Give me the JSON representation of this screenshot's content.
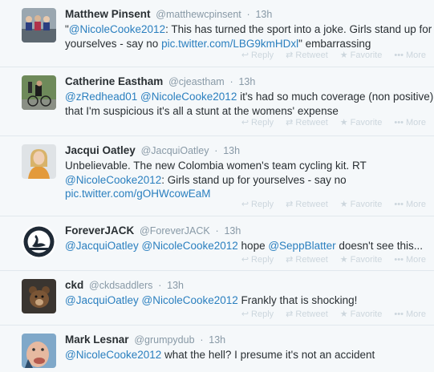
{
  "actions": {
    "reply": "Reply",
    "retweet": "Retweet",
    "favorite": "Favorite",
    "more": "More"
  },
  "tweets": [
    {
      "name": "Matthew Pinsent",
      "handle": "@matthewcpinsent",
      "time": "13h",
      "line1": [
        {
          "t": "\"",
          "c": "txt"
        },
        {
          "t": "@NicoleCooke2012",
          "c": "link"
        },
        {
          "t": ": This has turned the sport into a joke. Girls stand up for",
          "c": "txt"
        }
      ],
      "line2": [
        {
          "t": "yourselves - say no ",
          "c": "txt"
        },
        {
          "t": "pic.twitter.com/LBG9kmHDxl",
          "c": "link"
        },
        {
          "t": "\" embarrassing",
          "c": "txt"
        }
      ],
      "line3": []
    },
    {
      "name": "Catherine Eastham",
      "handle": "@cjeastham",
      "time": "13h",
      "line1": [
        {
          "t": "@zRedhead01",
          "c": "link"
        },
        {
          "t": " ",
          "c": "txt"
        },
        {
          "t": "@NicoleCooke2012",
          "c": "link"
        },
        {
          "t": " it's had so much coverage (non positive)",
          "c": "txt"
        }
      ],
      "line2": [
        {
          "t": "that I'm suspicious it's all a stunt at the womens' expense",
          "c": "txt"
        }
      ],
      "line3": []
    },
    {
      "name": "Jacqui Oatley",
      "handle": "@JacquiOatley",
      "time": "13h",
      "line1": [
        {
          "t": "Unbelievable. The new Colombia women's team cycling kit. RT",
          "c": "txt"
        }
      ],
      "line2": [
        {
          "t": "@NicoleCooke2012",
          "c": "link"
        },
        {
          "t": ": Girls stand up for yourselves - say no",
          "c": "txt"
        }
      ],
      "line3": [
        {
          "t": "pic.twitter.com/gOHWcowEaM",
          "c": "link"
        }
      ]
    },
    {
      "name": "ForeverJACK",
      "handle": "@ForeverJACK",
      "time": "13h",
      "line1": [
        {
          "t": "@JacquiOatley",
          "c": "link"
        },
        {
          "t": " ",
          "c": "txt"
        },
        {
          "t": "@NicoleCooke2012",
          "c": "link"
        },
        {
          "t": " hope ",
          "c": "txt"
        },
        {
          "t": "@SeppBlatter",
          "c": "link"
        },
        {
          "t": " doesn't see this...",
          "c": "txt"
        }
      ],
      "line2": [],
      "line3": []
    },
    {
      "name": "ckd",
      "handle": "@ckdsaddlers",
      "time": "13h",
      "line1": [
        {
          "t": "@JacquiOatley",
          "c": "link"
        },
        {
          "t": " ",
          "c": "txt"
        },
        {
          "t": "@NicoleCooke2012",
          "c": "link"
        },
        {
          "t": " Frankly that is shocking!",
          "c": "txt"
        }
      ],
      "line2": [],
      "line3": []
    },
    {
      "name": "Mark Lesnar",
      "handle": "@grumpydub",
      "time": "13h",
      "line1": [
        {
          "t": "@NicoleCooke2012",
          "c": "link"
        },
        {
          "t": " what the hell? I presume it's not an accident",
          "c": "txt"
        }
      ],
      "line2": [],
      "line3": []
    }
  ]
}
